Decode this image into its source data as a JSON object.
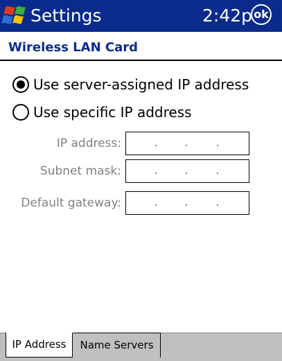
{
  "titlebar": {
    "title": "Settings",
    "time": "2:42p",
    "ok_label": "ok"
  },
  "section": {
    "title": "Wireless LAN Card"
  },
  "options": [
    {
      "label": "Use server-assigned IP address",
      "selected": true
    },
    {
      "label": "Use specific IP address",
      "selected": false
    }
  ],
  "fields": [
    {
      "label": "IP address:",
      "value": ". . ."
    },
    {
      "label": "Subnet mask:",
      "value": ". . ."
    },
    {
      "label": "Default gateway:",
      "value": ". . ."
    }
  ],
  "tabs": [
    {
      "label": "IP Address",
      "active": true
    },
    {
      "label": "Name Servers",
      "active": false
    }
  ],
  "colors": {
    "titlebar_bg": "#0a2b8c",
    "section_title": "#0a2b8c",
    "disabled_text": "#808080",
    "tabstrip_bg": "#c0c0c0"
  }
}
